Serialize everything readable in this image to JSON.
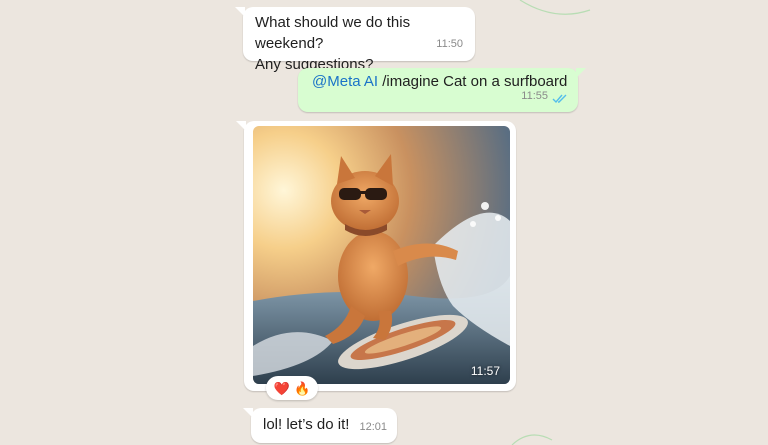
{
  "messages": [
    {
      "id": "weekend-question",
      "direction": "incoming",
      "lines": [
        "What should we do this weekend?",
        "Any suggestions?"
      ],
      "time": "11:50"
    },
    {
      "id": "imagine-command",
      "direction": "outgoing",
      "mention": "@Meta AI",
      "text": " /imagine Cat on a surfboard",
      "time": "11:55",
      "status": "read",
      "status_icon": "double-check-icon"
    },
    {
      "id": "generated-image",
      "direction": "incoming",
      "image": "cat-on-surfboard-image",
      "time": "11:57",
      "reactions": [
        {
          "emoji": "❤️",
          "icon": "heart-icon"
        },
        {
          "emoji": "🔥",
          "icon": "fire-icon"
        }
      ]
    },
    {
      "id": "reply",
      "direction": "incoming",
      "text": "lol! let’s do it!",
      "time": "12:01"
    }
  ],
  "colors": {
    "chat_background": "#ece6df",
    "incoming_bubble": "#ffffff",
    "outgoing_bubble": "#d8fdd1",
    "mention": "#1a73c8",
    "read_ticks": "#53bdeb",
    "timestamp": "#8a8a8a"
  }
}
